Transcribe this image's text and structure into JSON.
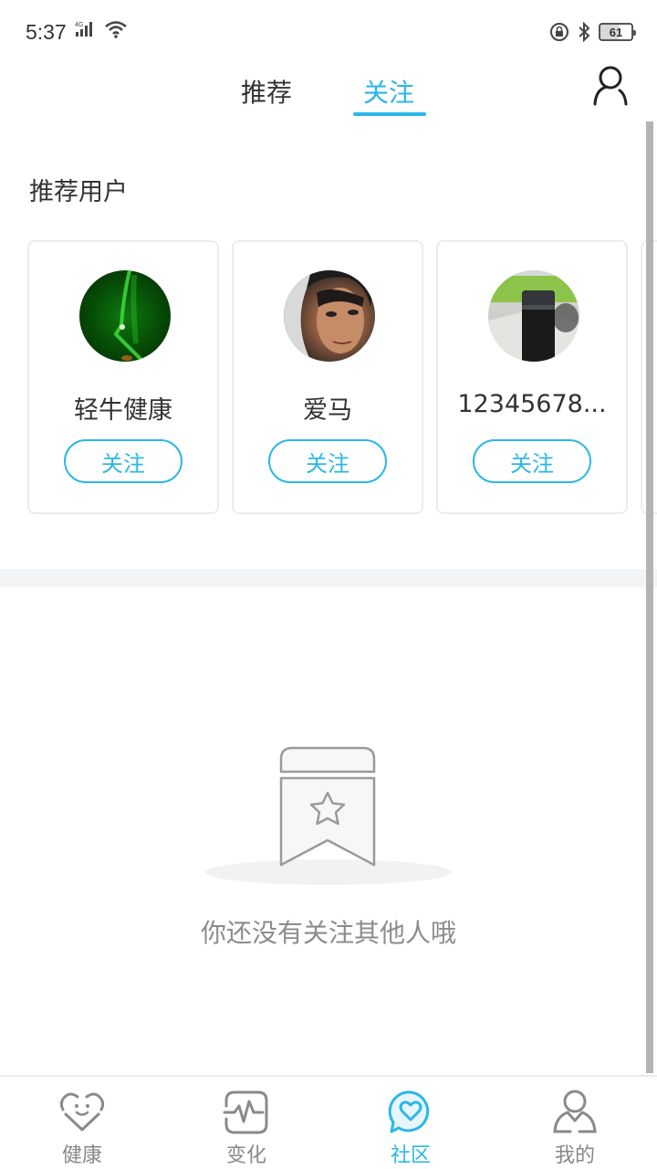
{
  "status_bar": {
    "time": "5:37",
    "network": "4G",
    "battery": "61"
  },
  "top_nav": {
    "tabs": [
      {
        "label": "推荐",
        "active": false
      },
      {
        "label": "关注",
        "active": true
      }
    ],
    "profile_icon": "person-outline-icon"
  },
  "recommended": {
    "title": "推荐用户",
    "users": [
      {
        "name": "轻牛健康",
        "follow_label": "关注",
        "avatar": "green-light-photo"
      },
      {
        "name": "爱马",
        "follow_label": "关注",
        "avatar": "man-portrait-photo"
      },
      {
        "name": "12345678...",
        "follow_label": "关注",
        "avatar": "thermos-bottle-photo"
      }
    ]
  },
  "empty_state": {
    "icon": "bookmark-star-icon",
    "message": "你还没有关注其他人哦"
  },
  "bottom_nav": {
    "items": [
      {
        "label": "健康",
        "icon": "heart-smile-icon",
        "active": false
      },
      {
        "label": "变化",
        "icon": "pulse-chart-icon",
        "active": false
      },
      {
        "label": "社区",
        "icon": "chat-heart-icon",
        "active": true
      },
      {
        "label": "我的",
        "icon": "person-icon",
        "active": false
      }
    ]
  },
  "colors": {
    "accent": "#2bb7e6",
    "text_primary": "#333333",
    "text_muted": "#8c8c8c",
    "separator": "#f3f4f6"
  }
}
